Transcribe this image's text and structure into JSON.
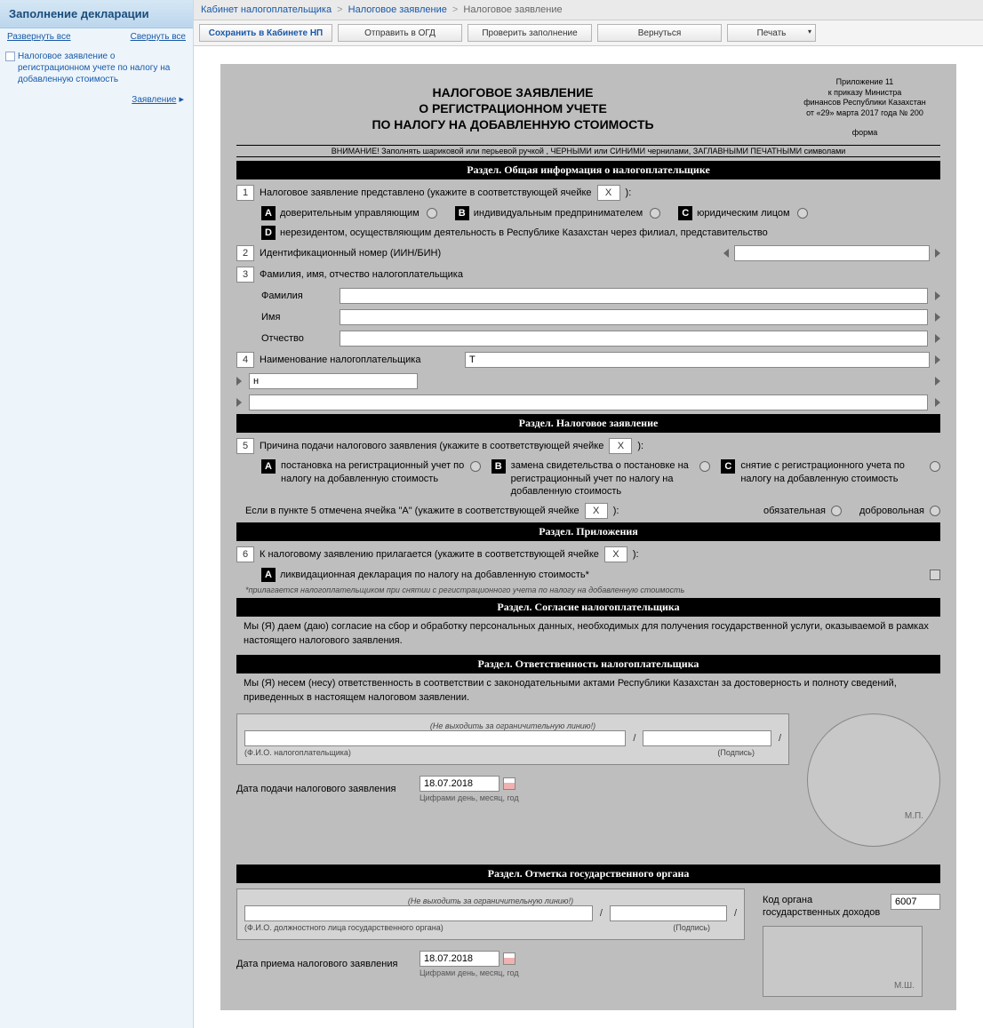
{
  "sidebar": {
    "title": "Заполнение декларации",
    "expandAll": "Развернуть все",
    "collapseAll": "Свернуть все",
    "item1": "Налоговое заявление о регистрационном учете по налогу на добавленную стоимость",
    "statementLink": "Заявление"
  },
  "breadcrumb": {
    "b1": "Кабинет налогоплательщика",
    "b2": "Налоговое заявление",
    "b3": "Налоговое заявление"
  },
  "toolbar": {
    "save": "Сохранить в Кабинете НП",
    "send": "Отправить в ОГД",
    "check": "Проверить заполнение",
    "back": "Вернуться",
    "print": "Печать"
  },
  "doc": {
    "title1": "НАЛОГОВОЕ ЗАЯВЛЕНИЕ",
    "title2": "О РЕГИСТРАЦИОННОМ УЧЕТЕ",
    "title3": "ПО НАЛОГУ НА ДОБАВЛЕННУЮ СТОИМОСТЬ",
    "annex1": "Приложение 11",
    "annex2": "к приказу Министра",
    "annex3": "финансов Республики Казахстан",
    "annex4": "от «29» марта 2017 года № 200",
    "annex5": "форма",
    "warning": "ВНИМАНИЕ! Заполнять шариковой или перьевой ручкой , ЧЕРНЫМИ или СИНИМИ чернилами, ЗАГЛАВНЫМИ ПЕЧАТНЫМИ символами",
    "sec1": "Раздел. Общая информация о налогоплательщике",
    "q1Label": "Налоговое заявление представлено (укажите в соответствующей ячейке",
    "x": "X",
    "close": "):",
    "optA": "доверительным управляющим",
    "optB": "индивидуальным предпринимателем",
    "optC": "юридическим лицом",
    "optD": "нерезидентом, осуществляющим деятельность в Республике Казахстан через филиал, представительство",
    "q2Label": "Идентификационный номер (ИИН/БИН)",
    "q3Label": "Фамилия, имя, отчество налогоплательщика",
    "surname": "Фамилия",
    "name": "Имя",
    "patronym": "Отчество",
    "q4Label": "Наименование налогоплательщика",
    "q4Val": "Т",
    "q4bVal": "н",
    "sec2": "Раздел. Налоговое заявление",
    "q5Label": "Причина подачи налогового заявления (укажите в соответствующей ячейке",
    "r5A": "постановка на регистрационный учет по налогу на добавленную стоимость",
    "r5B": "замена свидетельства о постановке на регистрационный учет по налогу на добавленную стоимость",
    "r5C": "снятие с регистрационного учета по налогу на добавленную стоимость",
    "q5cond": "Если в пункте 5 отмечена ячейка   \"А\"   (укажите в соответствующей ячейке",
    "mandatory": "обязательная",
    "voluntary": "добровольная",
    "sec3": "Раздел. Приложения",
    "q6Label": "К налоговому заявлению прилагается  (укажите в соответствующей ячейке",
    "q6A": "ликвидационная декларация по налогу на добавленную стоимость*",
    "q6note": "*прилагается налогоплательщиком при снятии с регистрационного учета по налогу на добавленную стоимость",
    "sec4": "Раздел. Согласие налогоплательщика",
    "consent": "Мы (Я) даем (даю) согласие на сбор и обработку персональных данных, необходимых для получения государственной услуги, оказываемой в рамках настоящего налогового заявления.",
    "sec5": "Раздел. Ответственность налогоплательщика",
    "resp": "Мы (Я) несем (несу) ответственность в соответствии с законодательными актами Республики Казахстан за достоверность и полноту сведений, приведенных в настоящем налоговом заявлении.",
    "noOut": "(Не выходить за ограничительную линию!)",
    "fioTax": "(Ф.И.О. налогоплательщика)",
    "signature": "(Подпись)",
    "submitDate": "Дата подачи налогового заявления",
    "date1": "18.07.2018",
    "dateHint": "Цифрами день, месяц, год",
    "mp": "М.П.",
    "sec6": "Раздел. Отметка государственного органа",
    "fioGov": "(Ф.И.О. должностного лица государственного органа)",
    "receiptDate": "Дата приема налогового заявления",
    "date2": "18.07.2018",
    "orgCode": "Код органа государственных доходов",
    "orgCodeVal": "6007",
    "ms": "М.Ш.",
    "n1": "1",
    "n2": "2",
    "n3": "3",
    "n4": "4",
    "n5": "5",
    "n6": "6",
    "A": "А",
    "B": "В",
    "C": "С",
    "D": "D"
  }
}
